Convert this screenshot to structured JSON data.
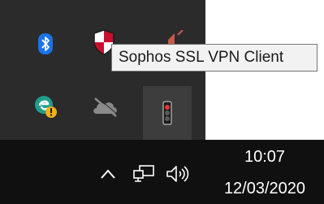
{
  "tooltip": {
    "text": "Sophos SSL VPN Client"
  },
  "overflow_icons": [
    {
      "name": "bluetooth-icon"
    },
    {
      "name": "sophos-shield-icon"
    },
    {
      "name": "volume-muted-icon"
    },
    {
      "name": "edge-update-icon"
    },
    {
      "name": "onedrive-offline-icon"
    },
    {
      "name": "sophos-vpn-traffic-light-icon"
    }
  ],
  "taskbar": {
    "icons": [
      "show-hidden-icons-chevron-icon",
      "network-icon",
      "volume-icon"
    ],
    "clock": {
      "time": "10:07",
      "date": "12/03/2020"
    }
  },
  "colors": {
    "panel_bg": "#2b2b2b",
    "taskbar_bg": "#101010",
    "bluetooth_blue": "#1a73e8",
    "traffic_light_red": "#e53935"
  }
}
